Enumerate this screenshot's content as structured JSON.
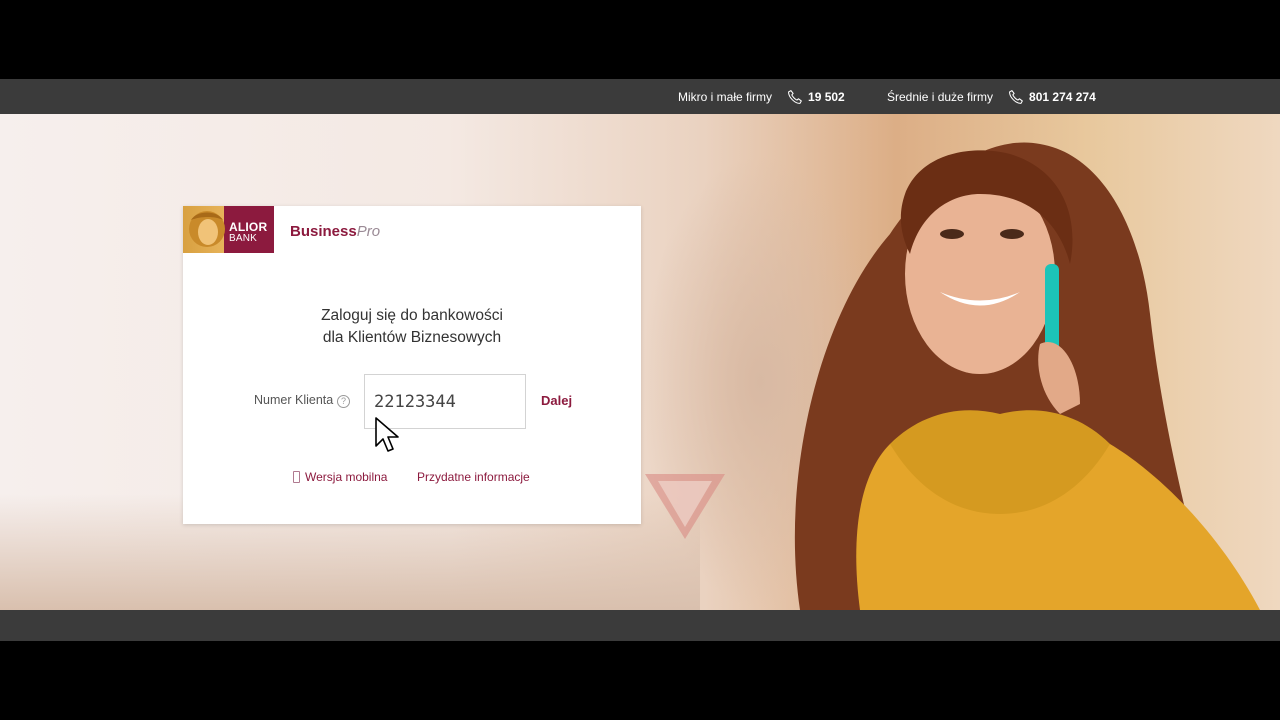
{
  "topbar": {
    "contacts": [
      {
        "label": "Mikro i małe firmy",
        "number": "19 502"
      },
      {
        "label": "Średnie i duże firmy",
        "number": "801 274 274"
      }
    ]
  },
  "logo": {
    "line1": "ALIOR",
    "line2": "BANK"
  },
  "product": {
    "name": "Business",
    "suffix": "Pro"
  },
  "login": {
    "heading_line1": "Zaloguj się do bankowości",
    "heading_line2": "dla Klientów Biznesowych",
    "field_label": "Numer Klienta",
    "help_symbol": "?",
    "client_number": "22123344",
    "next_label": "Dalej"
  },
  "links": {
    "mobile": "Wersja mobilna",
    "info": "Przydatne informacje"
  },
  "colors": {
    "brand": "#8c1a3e",
    "topbar": "#3b3b3b",
    "logo_gold": "#e7b35a"
  },
  "icons": [
    "phone-icon",
    "help-icon",
    "mobile-phone-icon",
    "mouse-cursor-icon"
  ]
}
